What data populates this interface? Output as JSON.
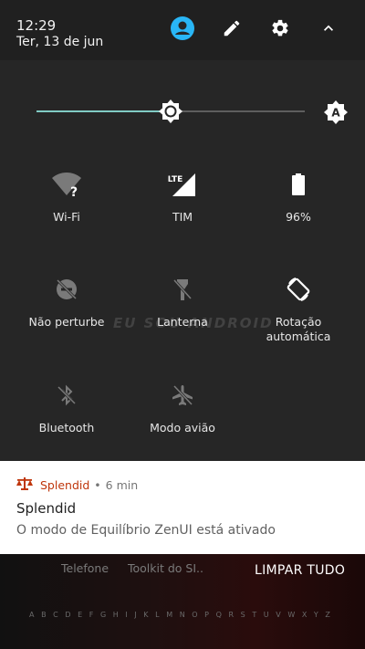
{
  "header": {
    "time": "12:29",
    "date": "Ter, 13 de jun",
    "icons": [
      "account-icon",
      "edit-icon",
      "settings-icon",
      "collapse-icon"
    ],
    "account_color": "#29b6f6"
  },
  "brightness": {
    "level": 0.5,
    "accent": "#80cbc4",
    "auto_label": "A"
  },
  "tiles": [
    {
      "label": "Wi-Fi",
      "icon": "wifi-unknown-icon"
    },
    {
      "label": "TIM",
      "icon": "lte-signal-icon",
      "badge": "LTE"
    },
    {
      "label": "96%",
      "icon": "battery-icon"
    },
    {
      "label": "Não perturbe",
      "icon": "do-not-disturb-icon"
    },
    {
      "label": "Lanterna",
      "icon": "flashlight-icon"
    },
    {
      "label": "Rotação\nautomática",
      "icon": "auto-rotate-icon"
    },
    {
      "label": "Bluetooth",
      "icon": "bluetooth-off-icon"
    },
    {
      "label": "Modo avião",
      "icon": "airplane-off-icon"
    }
  ],
  "watermark": "EU SOU ANDROID",
  "notification": {
    "app": "Splendid",
    "separator": "•",
    "time": "6 min",
    "title": "Splendid",
    "text": "O modo de Equilíbrio ZenUI está ativado",
    "app_color": "#bf360c"
  },
  "background": {
    "app_1": "Telefone",
    "app_2": "Toolkit do SI..",
    "clear_all": "LIMPAR TUDO",
    "alphabet": [
      "A",
      "B",
      "C",
      "D",
      "E",
      "F",
      "G",
      "H",
      "I",
      "J",
      "K",
      "L",
      "M",
      "N",
      "O",
      "P",
      "Q",
      "R",
      "S",
      "T",
      "U",
      "V",
      "W",
      "X",
      "Y",
      "Z"
    ]
  }
}
